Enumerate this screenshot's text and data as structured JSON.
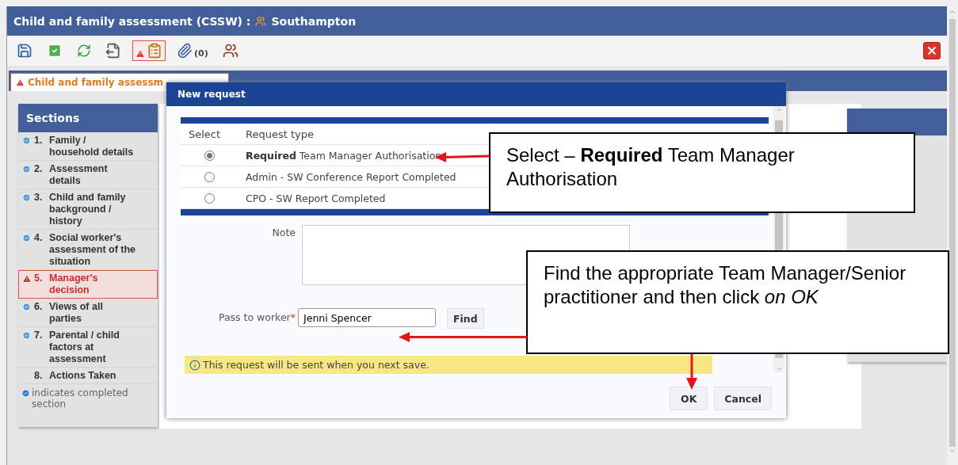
{
  "window": {
    "title": "Child and family assessment (CSSW) :",
    "location": "Southampton"
  },
  "toolbar": [
    {
      "kind": "save",
      "selected": false
    },
    {
      "kind": "complete",
      "selected": false
    },
    {
      "kind": "refresh",
      "selected": false
    },
    {
      "kind": "export",
      "selected": false
    },
    {
      "kind": "requests",
      "selected": true
    },
    {
      "kind": "attach",
      "count": "(0)",
      "selected": false
    },
    {
      "kind": "people",
      "selected": false
    }
  ],
  "tab": {
    "label": "Child and family assessm",
    "warning": true
  },
  "sections": {
    "title": "Sections",
    "items": [
      {
        "number": "1.",
        "label": "Family / household details",
        "complete": true,
        "warning": false,
        "selected": false
      },
      {
        "number": "2.",
        "label": "Assessment details",
        "complete": true,
        "warning": false,
        "selected": false
      },
      {
        "number": "3.",
        "label": "Child and family background / history",
        "complete": true,
        "warning": false,
        "selected": false
      },
      {
        "number": "4.",
        "label": "Social worker's assessment of the situation",
        "complete": true,
        "warning": false,
        "selected": false
      },
      {
        "number": "5.",
        "label": "Manager's decision",
        "complete": false,
        "warning": true,
        "selected": true
      },
      {
        "number": "6.",
        "label": "Views of all parties",
        "complete": true,
        "warning": false,
        "selected": false
      },
      {
        "number": "7.",
        "label": "Parental / child factors at assessment",
        "complete": true,
        "warning": false,
        "selected": false
      },
      {
        "number": "8.",
        "label": "Actions Taken",
        "complete": false,
        "warning": false,
        "selected": false
      }
    ],
    "legend": "indicates completed section"
  },
  "dialog": {
    "title": "New request",
    "table": {
      "columns": [
        "Select",
        "Request type"
      ],
      "rows": [
        {
          "label": "**Required** Team Manager Authorisation",
          "selected": true
        },
        {
          "label": "Admin - SW Conference Report Completed",
          "selected": false
        },
        {
          "label": "CPO - SW Report Completed",
          "selected": false
        }
      ]
    },
    "note_label": "Note",
    "worker_label": "Pass to worker",
    "worker_required_mark": "*",
    "worker_value": "Jenni Spencer",
    "find_button": "Find",
    "info": "This request will be sent when you next save.",
    "buttons": [
      "OK",
      "Cancel"
    ]
  },
  "callouts": [
    {
      "text": "Select – **Required** Team Manager Authorisation"
    },
    {
      "text": "Find the appropriate Team Manager/Senior practitioner and then click *on OK*"
    }
  ]
}
